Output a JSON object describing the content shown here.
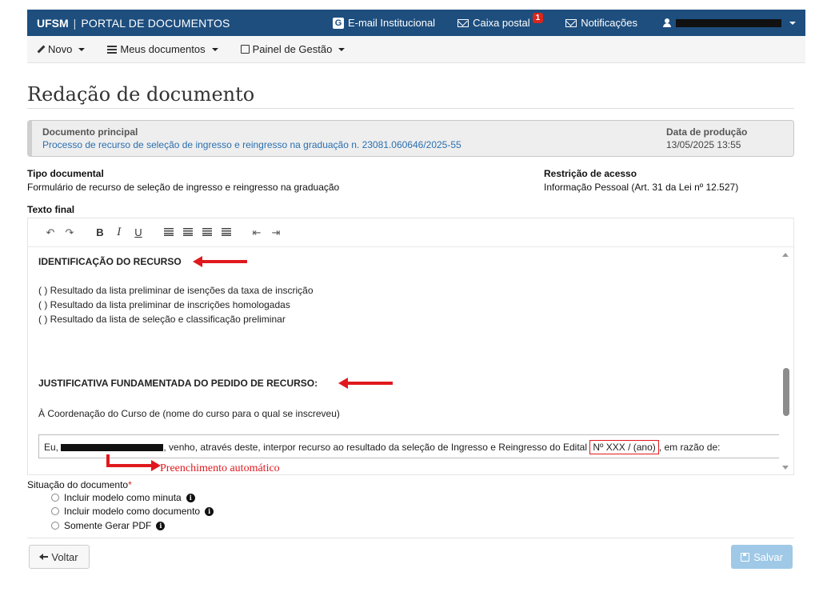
{
  "topbar": {
    "brand_short": "UFSM",
    "brand_separator": "|",
    "brand_title": "PORTAL DE DOCUMENTOS",
    "email_label": "E-mail Institucional",
    "inbox_label": "Caixa postal",
    "inbox_badge": "1",
    "notifications_label": "Notificações"
  },
  "menu": {
    "new_label": "Novo",
    "my_docs_label": "Meus documentos",
    "panel_label": "Painel de Gestão"
  },
  "page": {
    "title": "Redação de documento"
  },
  "main_doc": {
    "label": "Documento principal",
    "value": "Processo de recurso de seleção de ingresso e reingresso na graduação n. 23081.060646/2025-55",
    "date_label": "Data de produção",
    "date_value": "13/05/2025 13:55"
  },
  "doc_type": {
    "label": "Tipo documental",
    "value": "Formulário de recurso de seleção de ingresso e reingresso na graduação"
  },
  "access": {
    "label": "Restrição de acesso",
    "value": "Informação Pessoal (Art. 31 da Lei nº 12.527)"
  },
  "final_text": {
    "label": "Texto final"
  },
  "editor": {
    "toolbar": {
      "undo": "↶",
      "redo": "↷",
      "bold": "B",
      "italic": "I",
      "underline": "U",
      "outdent": "⇤",
      "indent": "⇥"
    },
    "section1_title": "IDENTIFICAÇÃO DO RECURSO",
    "options": [
      "(   ) Resultado da lista preliminar de isenções da taxa de inscrição",
      "(   ) Resultado da lista preliminar de inscrições homologadas",
      "(   ) Resultado da lista de seleção e classificação preliminar"
    ],
    "section2_title": "JUSTIFICATIVA FUNDAMENTADA DO PEDIDO DE RECURSO:",
    "addressee": "À Coordenação do Curso de (nome do curso para o qual se inscreveu)",
    "statement_prefix": "Eu,",
    "statement_middle": ", venho, através deste, interpor recurso ao resultado da seleção de Ingresso e Reingresso do Edital",
    "statement_highlight": "Nº XXX / (ano)",
    "statement_suffix": ", em razão de:",
    "annotation": "Preenchimento automático"
  },
  "status": {
    "label": "Situação do documento",
    "required_mark": "*",
    "options": [
      "Incluir modelo como minuta",
      "Incluir modelo como documento",
      "Somente Gerar PDF"
    ]
  },
  "actions": {
    "back_label": "Voltar",
    "save_label": "Salvar"
  },
  "colors": {
    "header": "#1d4e7e",
    "link": "#2a6fb0",
    "annotation_red": "#e0191e",
    "save_disabled": "#9fc9e6"
  }
}
